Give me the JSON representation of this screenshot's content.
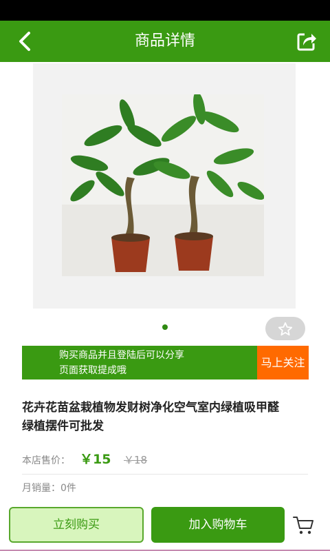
{
  "header": {
    "title": "商品详情",
    "back_icon": "chevron-left-icon",
    "share_icon": "share-icon"
  },
  "gallery": {
    "image": "potted-money-tree-photo",
    "active_dot": 1,
    "total_dots": 1
  },
  "favorite": {
    "icon": "star-outline-icon"
  },
  "promo": {
    "line1": "购买商品并且登陆后可以分享",
    "line2": "页面获取提成哦",
    "follow_label": "马上关注"
  },
  "product": {
    "title_line1": "花卉花苗盆栽植物发财树净化空气室内绿植吸甲醛",
    "title_line2": "绿植摆件可批发",
    "price_label": "本店售价：",
    "price_now": "￥15",
    "price_old": "￥18",
    "sales": "月销量：0件"
  },
  "actions": {
    "buy_now": "立刻购买",
    "add_to_cart": "加入购物车",
    "cart_icon": "shopping-cart-icon"
  },
  "colors": {
    "brand_green": "#3a9a12",
    "accent_orange": "#ff6a00"
  }
}
